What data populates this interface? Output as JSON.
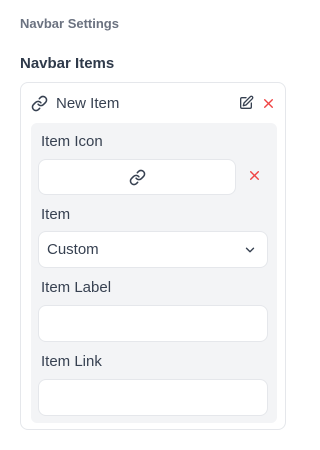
{
  "settings": {
    "title": "Navbar Settings"
  },
  "navbar_items": {
    "title": "Navbar Items",
    "items": [
      {
        "name": "New Item",
        "header_icon": "link-icon",
        "edit_icon": "edit-icon",
        "delete_icon": "close-icon",
        "fields": {
          "icon": {
            "label": "Item Icon",
            "value_icon": "link-icon",
            "remove_icon": "close-icon"
          },
          "item": {
            "label": "Item",
            "selected": "Custom",
            "dropdown_icon": "chevron-down-icon"
          },
          "label": {
            "label": "Item Label",
            "value": "",
            "placeholder": ""
          },
          "link": {
            "label": "Item Link",
            "value": "",
            "placeholder": ""
          }
        }
      }
    ]
  },
  "colors": {
    "danger": "#ef4444",
    "muted": "#6b7280",
    "panel": "#f3f4f6"
  }
}
